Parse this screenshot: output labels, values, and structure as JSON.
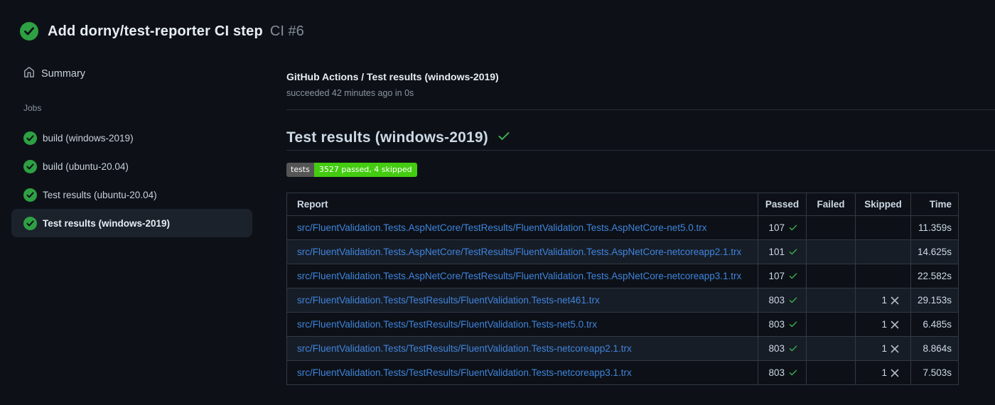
{
  "colors": {
    "page_bg": "#0d1117",
    "success_circle_green": "#2ea043",
    "check_green": "#3fb950",
    "link_blue": "#3f84dc",
    "badge_label_bg": "#555555",
    "badge_value_bg": "#44cc11",
    "selected_item_bg": "#1c222b"
  },
  "run_header": {
    "title": "Add dorny/test-reporter CI step",
    "run_number": "CI #6"
  },
  "sidebar": {
    "summary_label": "Summary",
    "jobs_section_label": "Jobs",
    "jobs": [
      {
        "label": "build (windows-2019)",
        "status": "success",
        "selected": false
      },
      {
        "label": "build (ubuntu-20.04)",
        "status": "success",
        "selected": false
      },
      {
        "label": "Test results (ubuntu-20.04)",
        "status": "success",
        "selected": false
      },
      {
        "label": "Test results (windows-2019)",
        "status": "success",
        "selected": true
      }
    ]
  },
  "main": {
    "breadcrumb": "GitHub Actions / Test results (windows-2019)",
    "status_line": "succeeded 42 minutes ago in 0s",
    "heading": "Test results (windows-2019)",
    "badge": {
      "label": "tests",
      "value": "3527 passed, 4 skipped"
    },
    "table": {
      "headers": [
        "Report",
        "Passed",
        "Failed",
        "Skipped",
        "Time"
      ],
      "rows": [
        {
          "report": "src/FluentValidation.Tests.AspNetCore/TestResults/FluentValidation.Tests.AspNetCore-net5.0.trx",
          "passed": "107",
          "failed": "",
          "skipped": "",
          "time": "11.359s"
        },
        {
          "report": "src/FluentValidation.Tests.AspNetCore/TestResults/FluentValidation.Tests.AspNetCore-netcoreapp2.1.trx",
          "passed": "101",
          "failed": "",
          "skipped": "",
          "time": "14.625s"
        },
        {
          "report": "src/FluentValidation.Tests.AspNetCore/TestResults/FluentValidation.Tests.AspNetCore-netcoreapp3.1.trx",
          "passed": "107",
          "failed": "",
          "skipped": "",
          "time": "22.582s"
        },
        {
          "report": "src/FluentValidation.Tests/TestResults/FluentValidation.Tests-net461.trx",
          "passed": "803",
          "failed": "",
          "skipped": "1",
          "time": "29.153s"
        },
        {
          "report": "src/FluentValidation.Tests/TestResults/FluentValidation.Tests-net5.0.trx",
          "passed": "803",
          "failed": "",
          "skipped": "1",
          "time": "6.485s"
        },
        {
          "report": "src/FluentValidation.Tests/TestResults/FluentValidation.Tests-netcoreapp2.1.trx",
          "passed": "803",
          "failed": "",
          "skipped": "1",
          "time": "8.864s"
        },
        {
          "report": "src/FluentValidation.Tests/TestResults/FluentValidation.Tests-netcoreapp3.1.trx",
          "passed": "803",
          "failed": "",
          "skipped": "1",
          "time": "7.503s"
        }
      ]
    }
  }
}
